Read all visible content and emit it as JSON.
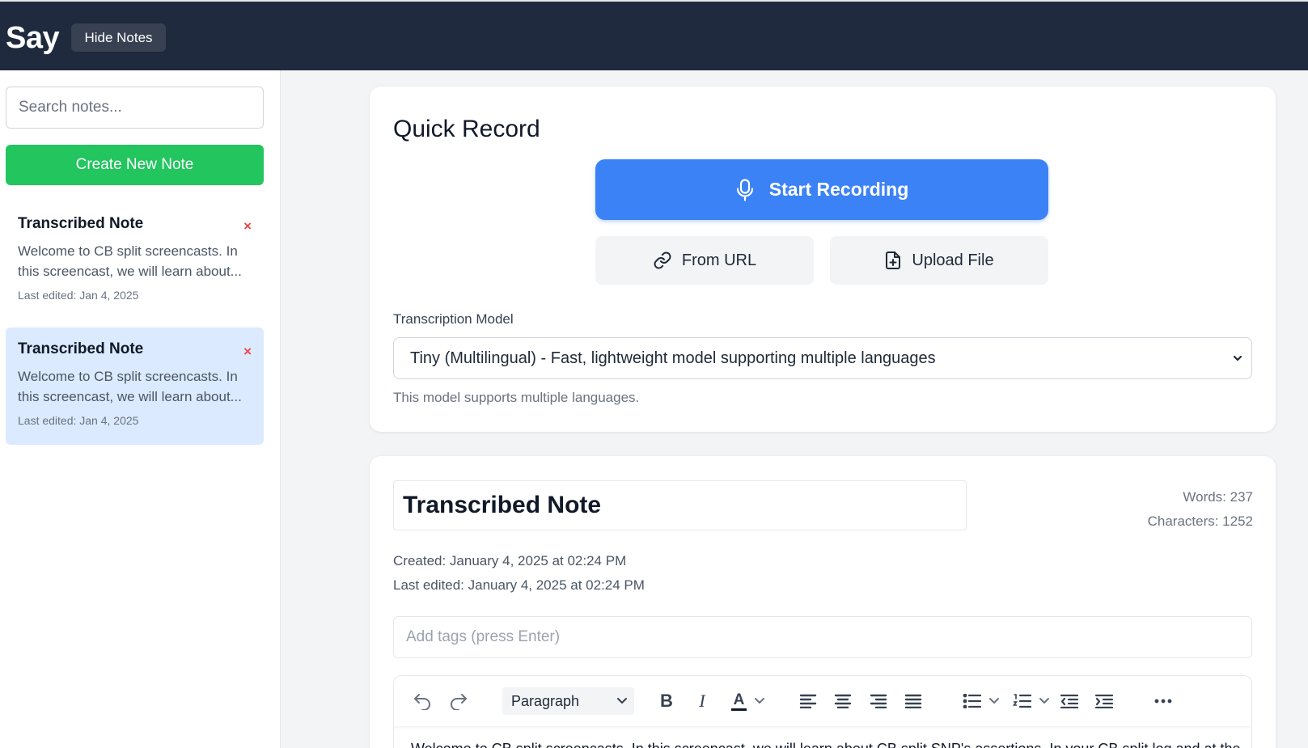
{
  "header": {
    "brand": "Say",
    "hide_notes_label": "Hide Notes"
  },
  "sidebar": {
    "search_placeholder": "Search notes...",
    "create_label": "Create New Note",
    "notes": [
      {
        "title": "Transcribed Note",
        "delete_glyph": "×",
        "preview": "Welcome to CB split screencasts. In this screencast, we will learn about...",
        "date": "Last edited: Jan 4, 2025",
        "active": false
      },
      {
        "title": "Transcribed Note",
        "delete_glyph": "×",
        "preview": "Welcome to CB split screencasts. In this screencast, we will learn about...",
        "date": "Last edited: Jan 4, 2025",
        "active": true
      }
    ]
  },
  "quick_record": {
    "title": "Quick Record",
    "start_label": "Start Recording",
    "from_url_label": "From URL",
    "upload_label": "Upload File",
    "model_label": "Transcription Model",
    "model_selected": "Tiny (Multilingual) - Fast, lightweight model supporting multiple languages",
    "model_help": "This model supports multiple languages."
  },
  "note": {
    "title": "Transcribed Note",
    "words": "Words: 237",
    "characters": "Characters: 1252",
    "created": "Created: January 4, 2025 at 02:24 PM",
    "last_edited": "Last edited: January 4, 2025 at 02:24 PM",
    "tags_placeholder": "Add tags (press Enter)",
    "block_format": "Paragraph",
    "body_text": "Welcome to CB split screencasts. In this screencast, we will learn about CB split SNP's assertions. In your CB split log and at the top"
  },
  "colors": {
    "header_bg": "#1f2a3e",
    "primary_blue": "#3b82f6",
    "create_green": "#22c55e",
    "active_note_bg": "#dbeafe",
    "delete_red": "#ef4444"
  },
  "icons": {
    "record": "microphone-icon",
    "from_url": "link-icon",
    "upload": "file-plus-icon",
    "undo": "undo-icon",
    "redo": "redo-icon",
    "bold": "bold-icon",
    "italic": "italic-icon",
    "text_color": "text-color-icon",
    "align_left": "align-left-icon",
    "align_center": "align-center-icon",
    "align_right": "align-right-icon",
    "align_justify": "align-justify-icon",
    "bullet_list": "bullet-list-icon",
    "numbered_list": "numbered-list-icon",
    "outdent": "outdent-icon",
    "indent": "indent-icon",
    "more": "more-icon"
  }
}
